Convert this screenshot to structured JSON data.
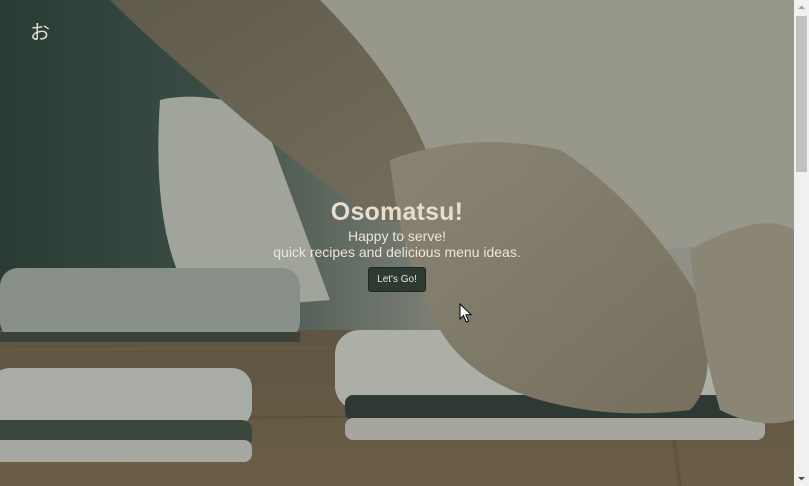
{
  "header": {
    "logo_text": "お"
  },
  "hero": {
    "title": "Osomatsu!",
    "tagline_line1": "Happy to serve!",
    "tagline_line2": "quick recipes and delicious menu ideas.",
    "cta_label": "Let's Go!"
  },
  "colors": {
    "overlay": "#3a4a42",
    "button_bg": "#2c3a32",
    "title_text": "#e8dccf",
    "wood": "#8a6a4a",
    "rice": "#e6e2d8",
    "nori": "#1c2420"
  },
  "icons": {
    "cursor": "mouse-pointer-icon",
    "scroll_up": "chevron-up-icon",
    "scroll_down": "chevron-down-icon"
  }
}
